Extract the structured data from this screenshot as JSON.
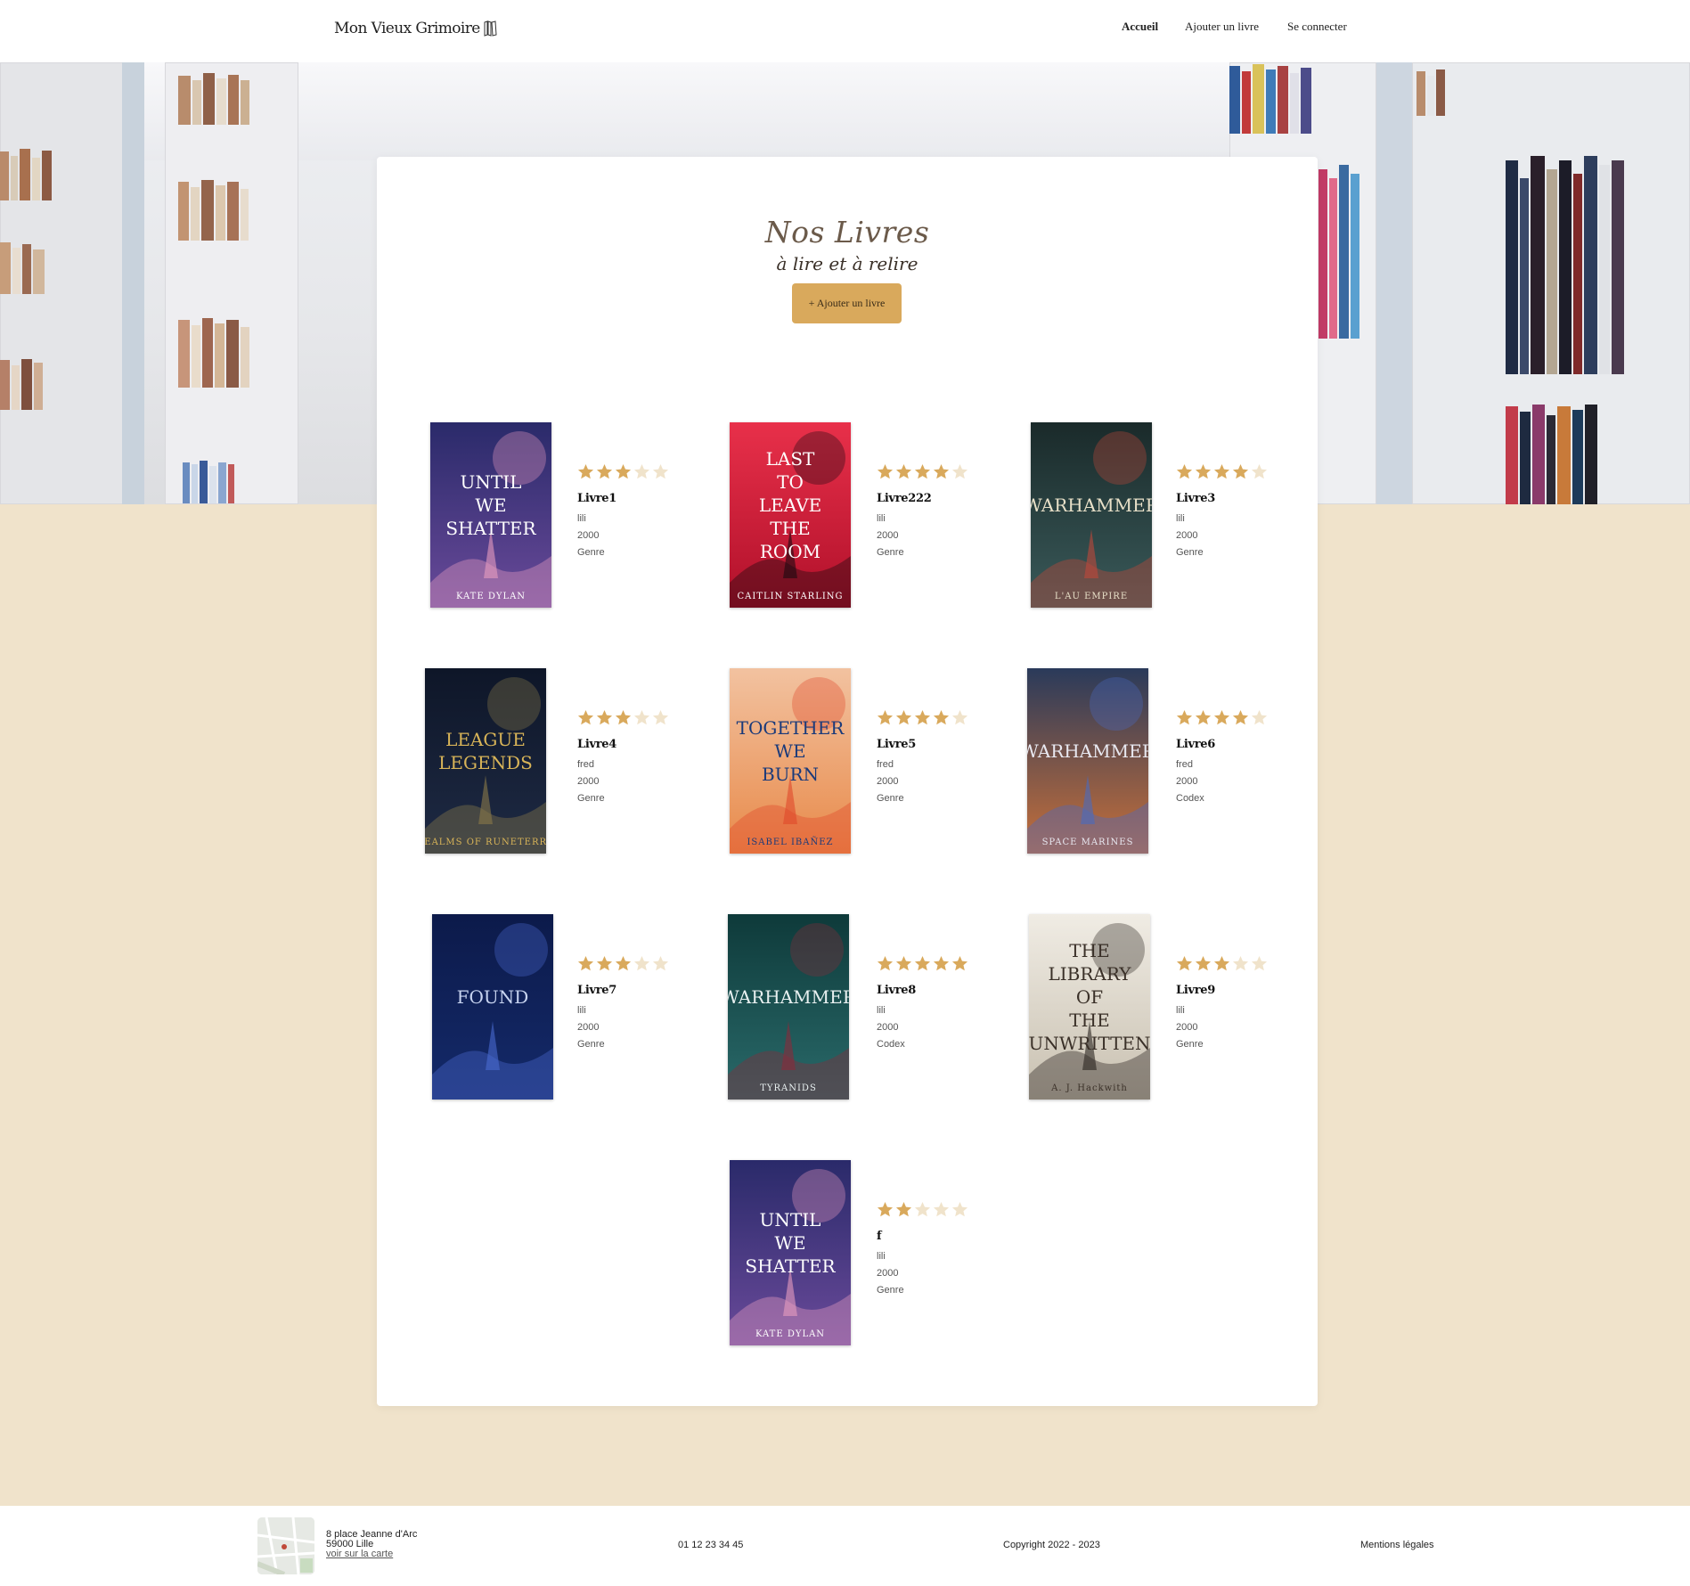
{
  "header": {
    "logo": "Mon Vieux Grimoire",
    "nav": [
      {
        "label": "Accueil",
        "active": true
      },
      {
        "label": "Ajouter un livre",
        "active": false
      },
      {
        "label": "Se connecter",
        "active": false
      }
    ]
  },
  "main": {
    "title": "Nos Livres",
    "subtitle": "à lire et à relire",
    "add_button": "+ Ajouter un livre"
  },
  "books": [
    {
      "title": "Livre1",
      "author": "lili",
      "year": "2000",
      "genre": "Genre",
      "rating": 3,
      "cover_text": "UNTIL WE SHATTER",
      "cover_author": "KATE DYLAN"
    },
    {
      "title": "Livre222",
      "author": "lili",
      "year": "2000",
      "genre": "Genre",
      "rating": 4,
      "cover_text": "LAST TO LEAVE THE ROOM",
      "cover_author": "CAITLIN STARLING"
    },
    {
      "title": "Livre3",
      "author": "lili",
      "year": "2000",
      "genre": "Genre",
      "rating": 4,
      "cover_text": "WARHAMMER",
      "cover_author": "L'AU EMPIRE"
    },
    {
      "title": "Livre4",
      "author": "fred",
      "year": "2000",
      "genre": "Genre",
      "rating": 3,
      "cover_text": "LEAGUE LEGENDS",
      "cover_author": "REALMS OF RUNETERRA"
    },
    {
      "title": "Livre5",
      "author": "fred",
      "year": "2000",
      "genre": "Genre",
      "rating": 4,
      "cover_text": "TOGETHER WE BURN",
      "cover_author": "ISABEL IBAÑEZ"
    },
    {
      "title": "Livre6",
      "author": "fred",
      "year": "2000",
      "genre": "Codex",
      "rating": 4,
      "cover_text": "WARHAMMER",
      "cover_author": "SPACE MARINES"
    },
    {
      "title": "Livre7",
      "author": "lili",
      "year": "2000",
      "genre": "Genre",
      "rating": 3,
      "cover_text": "FOUND",
      "cover_author": ""
    },
    {
      "title": "Livre8",
      "author": "lili",
      "year": "2000",
      "genre": "Codex",
      "rating": 5,
      "cover_text": "WARHAMMER",
      "cover_author": "TYRANIDS"
    },
    {
      "title": "Livre9",
      "author": "lili",
      "year": "2000",
      "genre": "Genre",
      "rating": 3,
      "cover_text": "THE LIBRARY OF THE UNWRITTEN",
      "cover_author": "A. J. Hackwith"
    },
    {
      "title": "f",
      "author": "lili",
      "year": "2000",
      "genre": "Genre",
      "rating": 2,
      "cover_text": "UNTIL WE SHATTER",
      "cover_author": "KATE DYLAN"
    }
  ],
  "footer": {
    "address_line1": "8 place Jeanne d'Arc",
    "address_line2": "59000 Lille",
    "map_link": "voir sur la carte",
    "phone": "01 12 23 34 45",
    "copyright": "Copyright 2022 - 2023",
    "legal": "Mentions légales"
  },
  "colors": {
    "accent": "#d9a95c",
    "page_bg": "#f0e3cb",
    "star_off": "#f0e3cb"
  }
}
